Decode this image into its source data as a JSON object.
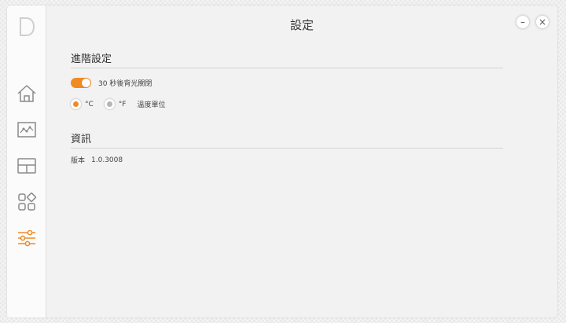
{
  "app": {
    "logo_letter": "D",
    "title": "設定",
    "minimize_symbol": "–",
    "close_symbol": "×"
  },
  "sidebar": {
    "items": [
      {
        "icon": "home-icon",
        "active": false
      },
      {
        "icon": "chart-icon",
        "active": false
      },
      {
        "icon": "layout-icon",
        "active": false
      },
      {
        "icon": "apps-icon",
        "active": false
      },
      {
        "icon": "sliders-icon",
        "active": true
      }
    ]
  },
  "advanced": {
    "heading": "進階設定",
    "backlight_label": "30 秒後背光關閉",
    "backlight_on": true,
    "unit_celsius": "°C",
    "unit_fahrenheit": "°F",
    "unit_selected": "°C",
    "unit_label": "溫度單位"
  },
  "info": {
    "heading": "資訊",
    "version_label": "版本",
    "version_value": "1.0.3008"
  },
  "colors": {
    "accent": "#f08a24",
    "icon_gray": "#8a8a8a"
  }
}
